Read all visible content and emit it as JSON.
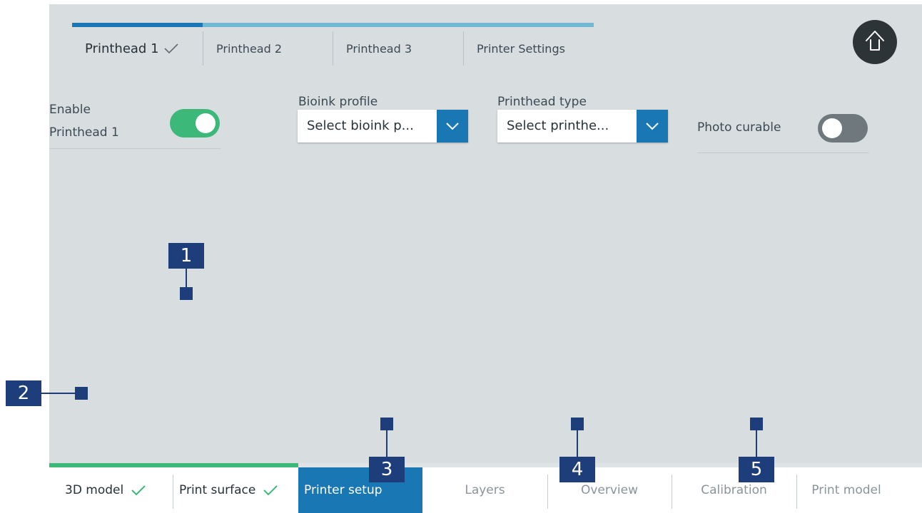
{
  "tabs": [
    {
      "label": "Printhead 1",
      "checked": true
    },
    {
      "label": "Printhead 2",
      "checked": false
    },
    {
      "label": "Printhead 3",
      "checked": false
    },
    {
      "label": "Printer Settings",
      "checked": false
    }
  ],
  "home": {
    "icon": "home-arrow-up-icon"
  },
  "settings": {
    "enable_label": "Enable Printhead 1",
    "enable_on": true,
    "bioink_label": "Bioink profile",
    "bioink_value": "Select bioink p...",
    "printhead_type_label": "Printhead type",
    "printhead_type_value": "Select printhe...",
    "photo_curable_label": "Photo curable",
    "photo_curable_on": false
  },
  "bottom_nav": [
    {
      "label": "3D model",
      "state": "done"
    },
    {
      "label": "Print surface",
      "state": "done"
    },
    {
      "label": "Printer setup",
      "state": "active"
    },
    {
      "label": "Layers",
      "state": "todo"
    },
    {
      "label": "Overview",
      "state": "todo"
    },
    {
      "label": "Calibration",
      "state": "todo"
    },
    {
      "label": "Print model",
      "state": "todo"
    }
  ],
  "callouts": [
    "1",
    "2",
    "3",
    "4",
    "5"
  ],
  "colors": {
    "accent_blue": "#1977b4",
    "light_blue": "#72b7d4",
    "success_green": "#3cb878",
    "callout_navy": "#1e3d7b",
    "panel_gray": "#d8dddf"
  }
}
